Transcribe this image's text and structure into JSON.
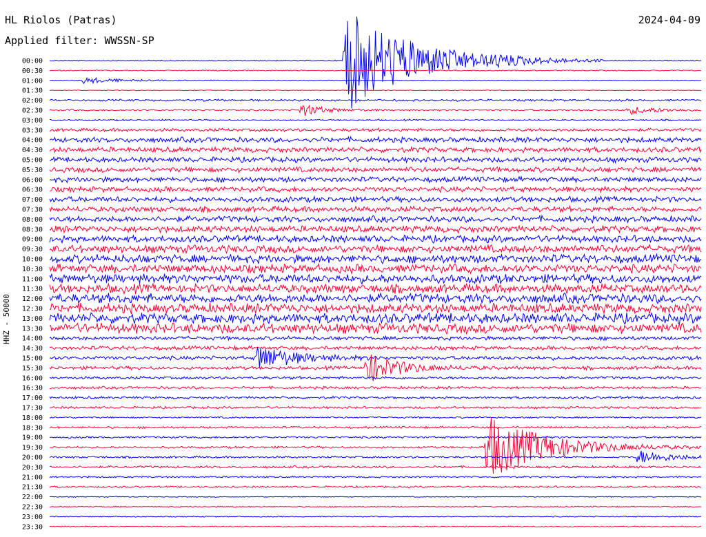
{
  "header": {
    "station": "HL Riolos (Patras)",
    "filter": "Applied filter: WWSSN-SP",
    "date": "2024-04-09"
  },
  "colors": {
    "trace_a": "#0000ff",
    "trace_b": "#ff0033"
  },
  "chart_data": {
    "type": "line",
    "title": "HL Riolos (Patras)",
    "subtitle": "Applied filter: WWSSN-SP",
    "date": "2024-04-09",
    "ylabel": "HHZ - 50000",
    "row_labels": [
      "00:00",
      "00:30",
      "01:00",
      "01:30",
      "02:00",
      "02:30",
      "03:00",
      "03:30",
      "04:00",
      "04:30",
      "05:00",
      "05:30",
      "06:00",
      "06:30",
      "07:00",
      "07:30",
      "08:00",
      "08:30",
      "09:00",
      "09:30",
      "10:00",
      "10:30",
      "11:00",
      "11:30",
      "12:00",
      "12:30",
      "13:00",
      "13:30",
      "14:00",
      "14:30",
      "15:00",
      "15:30",
      "16:00",
      "16:30",
      "17:00",
      "17:30",
      "18:00",
      "18:30",
      "19:00",
      "19:30",
      "20:00",
      "20:30",
      "21:00",
      "21:30",
      "22:00",
      "22:30",
      "23:00",
      "23:30"
    ],
    "row_noise_level": [
      0.5,
      0.6,
      0.4,
      0.4,
      1.2,
      0.9,
      1.0,
      1.8,
      3.0,
      3.0,
      3.0,
      3.0,
      3.0,
      3.0,
      3.2,
      3.2,
      3.5,
      3.8,
      4.0,
      4.5,
      4.8,
      5.0,
      5.2,
      5.2,
      5.5,
      5.5,
      5.8,
      5.8,
      2.2,
      2.2,
      2.2,
      2.0,
      1.6,
      1.5,
      1.4,
      1.3,
      1.0,
      1.2,
      1.2,
      1.2,
      1.2,
      1.4,
      1.0,
      1.0,
      0.6,
      0.6,
      0.6,
      0.6
    ],
    "events": [
      {
        "row": 0,
        "minute": 13.5,
        "amplitude": 80,
        "duration": 3.0
      },
      {
        "row": 0,
        "minute": 20.5,
        "amplitude": 4,
        "duration": 1.0
      },
      {
        "row": 2,
        "minute": 1.5,
        "amplitude": 5,
        "duration": 1.5
      },
      {
        "row": 5,
        "minute": 11.5,
        "amplitude": 10,
        "duration": 1.0
      },
      {
        "row": 5,
        "minute": 26.5,
        "amplitude": 6,
        "duration": 1.5
      },
      {
        "row": 30,
        "minute": 9.5,
        "amplitude": 20,
        "duration": 1.5
      },
      {
        "row": 31,
        "minute": 14.5,
        "amplitude": 22,
        "duration": 1.5
      },
      {
        "row": 39,
        "minute": 20.0,
        "amplitude": 50,
        "duration": 2.5
      },
      {
        "row": 40,
        "minute": 27.0,
        "amplitude": 10,
        "duration": 1.5
      }
    ]
  }
}
